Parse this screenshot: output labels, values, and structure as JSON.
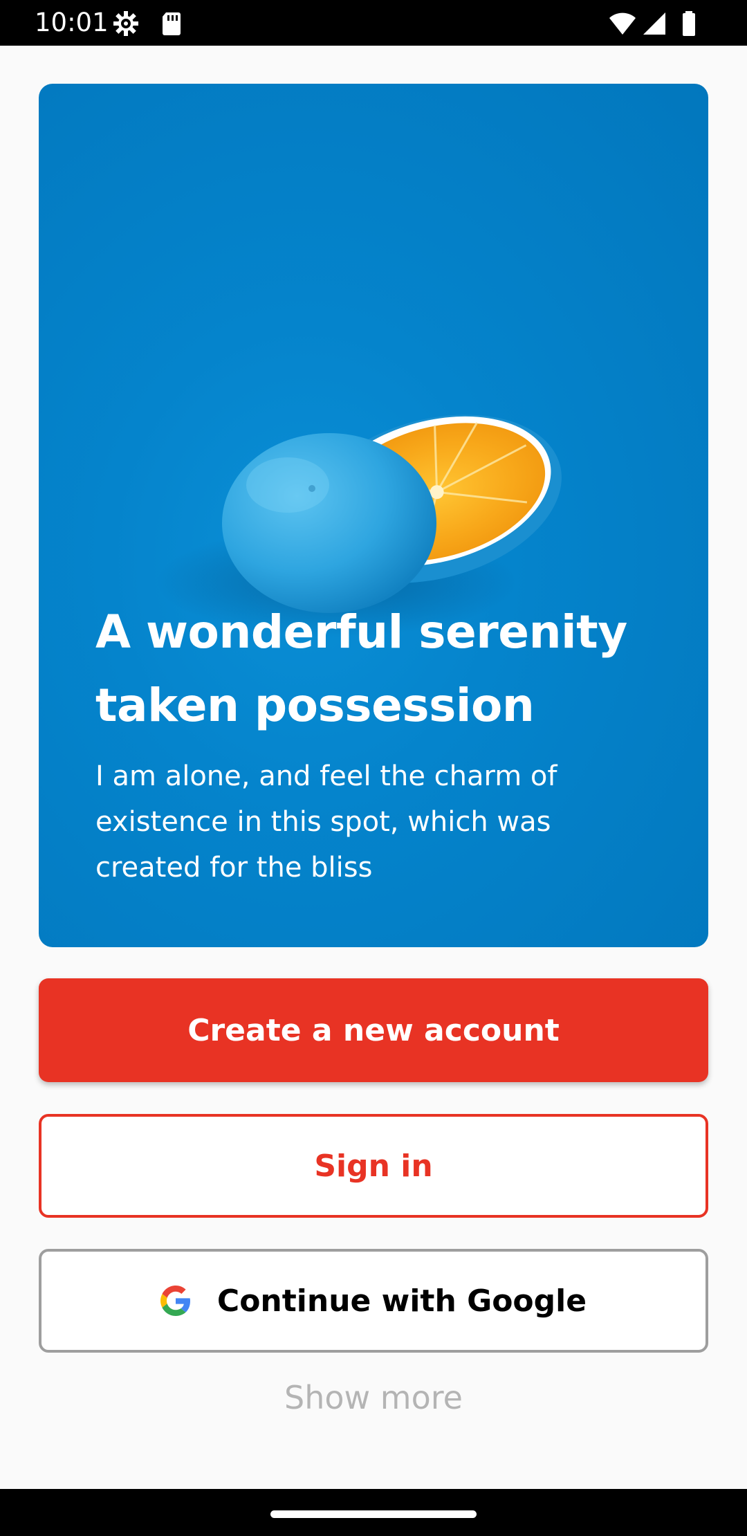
{
  "status_bar": {
    "time": "10:01",
    "icons": [
      "settings-gear-icon",
      "sd-card-icon",
      "wifi-icon",
      "cellular-signal-icon",
      "battery-icon"
    ]
  },
  "hero": {
    "title": "A wonderful serenity taken possession",
    "subtitle": "I am alone, and feel the charm of existence in this spot, which was created for the bliss",
    "image": "blue-painted-orange-halves"
  },
  "actions": {
    "create_account": "Create a new account",
    "sign_in": "Sign in",
    "google": "Continue with Google",
    "show_more": "Show more"
  },
  "colors": {
    "primary": "#e83324",
    "hero_blue": "#0584cc",
    "background": "#fafafa",
    "muted_text": "#b4b4b4"
  }
}
